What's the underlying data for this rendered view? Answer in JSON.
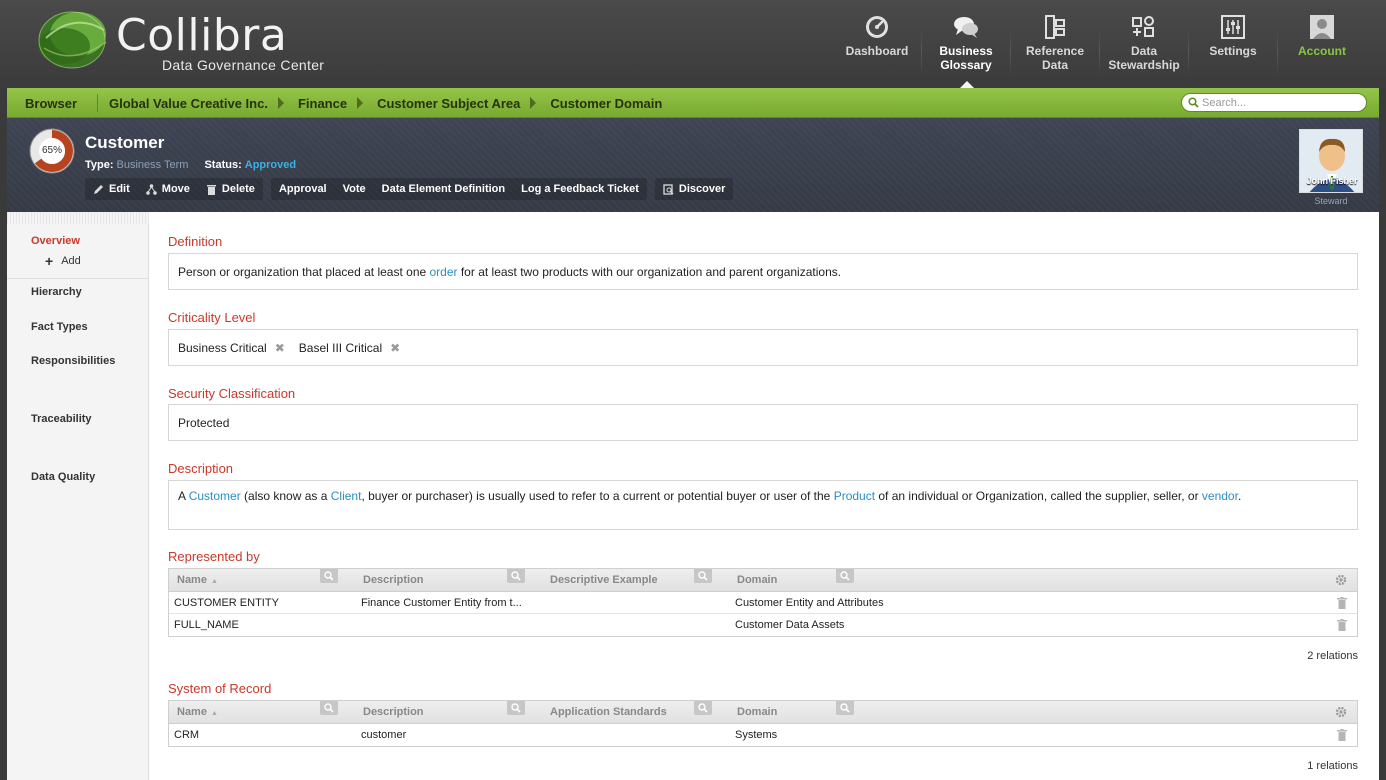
{
  "brand": {
    "name": "Collibra",
    "subtitle": "Data Governance Center"
  },
  "nav": {
    "items": [
      {
        "line1": "Dashboard",
        "line2": "",
        "icon": "dashboard-icon"
      },
      {
        "line1": "Business",
        "line2": "Glossary",
        "icon": "chat-bubbles-icon",
        "active": true
      },
      {
        "line1": "Reference",
        "line2": "Data",
        "icon": "reference-data-icon"
      },
      {
        "line1": "Data",
        "line2": "Stewardship",
        "icon": "stewardship-icon"
      },
      {
        "line1": "Settings",
        "line2": "",
        "icon": "settings-sliders-icon"
      },
      {
        "line1": "Account",
        "line2": "",
        "icon": "account-user-icon"
      }
    ]
  },
  "breadcrumb": {
    "browser": "Browser",
    "items": [
      "Global Value Creative Inc.",
      "Finance",
      "Customer Subject Area",
      "Customer Domain"
    ],
    "search_placeholder": "Search..."
  },
  "asset": {
    "completeness": "65%",
    "completeness_value": 65,
    "title": "Customer",
    "type_label": "Type:",
    "type_value": "Business Term",
    "status_label": "Status:",
    "status_value": "Approved",
    "actions": {
      "edit": "Edit",
      "move": "Move",
      "delete": "Delete",
      "approval": "Approval",
      "vote": "Vote",
      "data_element_definition": "Data Element Definition",
      "log_feedback": "Log a Feedback Ticket",
      "discover": "Discover"
    },
    "steward": {
      "name": "John Fisher",
      "role": "Steward"
    }
  },
  "sidebar": {
    "overview": "Overview",
    "add": "Add",
    "hierarchy": "Hierarchy",
    "fact_types": "Fact Types",
    "responsibilities": "Responsibilities",
    "traceability": "Traceability",
    "data_quality": "Data Quality"
  },
  "definition": {
    "title": "Definition",
    "text_before": "Person or organization that placed at least one ",
    "link": "order",
    "text_after": " for at least two products with our organization and parent organizations."
  },
  "criticality": {
    "title": "Criticality Level",
    "tags": [
      "Business Critical",
      "Basel III Critical"
    ]
  },
  "security": {
    "title": "Security Classification",
    "value": "Protected"
  },
  "description": {
    "title": "Description",
    "p1": "A ",
    "l1": "Customer",
    "p2": " (also know as a ",
    "l2": "Client",
    "p3": ", buyer or purchaser) is usually used to refer to a current or potential buyer or user of the ",
    "l3": "Product",
    "p4": " of an individual or Organization, called the supplier, seller, or ",
    "l4": "vendor",
    "p5": "."
  },
  "represented_by": {
    "title": "Represented by",
    "columns": [
      "Name",
      "Description",
      "Descriptive Example",
      "Domain"
    ],
    "rows": [
      {
        "name": "CUSTOMER ENTITY",
        "description": "Finance Customer Entity from t...",
        "example": "",
        "domain": "Customer Entity and Attributes"
      },
      {
        "name": "FULL_NAME",
        "description": "",
        "example": "",
        "domain": "Customer Data Assets"
      }
    ],
    "count": "2 relations"
  },
  "system_of_record": {
    "title": "System of Record",
    "columns": [
      "Name",
      "Description",
      "Application Standards",
      "Domain"
    ],
    "rows": [
      {
        "name": "CRM",
        "description": "customer",
        "example": "",
        "domain": "Systems"
      }
    ],
    "count": "1 relations"
  },
  "colors": {
    "accent_green": "#8cc63f",
    "accent_red": "#c8392b",
    "link_blue": "#2a8fc4",
    "status_blue": "#3cb0e0"
  }
}
